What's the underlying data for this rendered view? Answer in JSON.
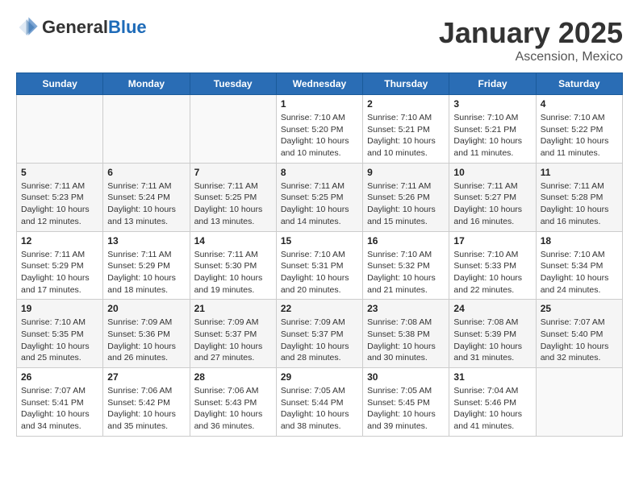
{
  "header": {
    "logo_general": "General",
    "logo_blue": "Blue",
    "month": "January 2025",
    "location": "Ascension, Mexico"
  },
  "days_of_week": [
    "Sunday",
    "Monday",
    "Tuesday",
    "Wednesday",
    "Thursday",
    "Friday",
    "Saturday"
  ],
  "weeks": [
    [
      {
        "day": "",
        "info": ""
      },
      {
        "day": "",
        "info": ""
      },
      {
        "day": "",
        "info": ""
      },
      {
        "day": "1",
        "info": "Sunrise: 7:10 AM\nSunset: 5:20 PM\nDaylight: 10 hours and 10 minutes."
      },
      {
        "day": "2",
        "info": "Sunrise: 7:10 AM\nSunset: 5:21 PM\nDaylight: 10 hours and 10 minutes."
      },
      {
        "day": "3",
        "info": "Sunrise: 7:10 AM\nSunset: 5:21 PM\nDaylight: 10 hours and 11 minutes."
      },
      {
        "day": "4",
        "info": "Sunrise: 7:10 AM\nSunset: 5:22 PM\nDaylight: 10 hours and 11 minutes."
      }
    ],
    [
      {
        "day": "5",
        "info": "Sunrise: 7:11 AM\nSunset: 5:23 PM\nDaylight: 10 hours and 12 minutes."
      },
      {
        "day": "6",
        "info": "Sunrise: 7:11 AM\nSunset: 5:24 PM\nDaylight: 10 hours and 13 minutes."
      },
      {
        "day": "7",
        "info": "Sunrise: 7:11 AM\nSunset: 5:25 PM\nDaylight: 10 hours and 13 minutes."
      },
      {
        "day": "8",
        "info": "Sunrise: 7:11 AM\nSunset: 5:25 PM\nDaylight: 10 hours and 14 minutes."
      },
      {
        "day": "9",
        "info": "Sunrise: 7:11 AM\nSunset: 5:26 PM\nDaylight: 10 hours and 15 minutes."
      },
      {
        "day": "10",
        "info": "Sunrise: 7:11 AM\nSunset: 5:27 PM\nDaylight: 10 hours and 16 minutes."
      },
      {
        "day": "11",
        "info": "Sunrise: 7:11 AM\nSunset: 5:28 PM\nDaylight: 10 hours and 16 minutes."
      }
    ],
    [
      {
        "day": "12",
        "info": "Sunrise: 7:11 AM\nSunset: 5:29 PM\nDaylight: 10 hours and 17 minutes."
      },
      {
        "day": "13",
        "info": "Sunrise: 7:11 AM\nSunset: 5:29 PM\nDaylight: 10 hours and 18 minutes."
      },
      {
        "day": "14",
        "info": "Sunrise: 7:11 AM\nSunset: 5:30 PM\nDaylight: 10 hours and 19 minutes."
      },
      {
        "day": "15",
        "info": "Sunrise: 7:10 AM\nSunset: 5:31 PM\nDaylight: 10 hours and 20 minutes."
      },
      {
        "day": "16",
        "info": "Sunrise: 7:10 AM\nSunset: 5:32 PM\nDaylight: 10 hours and 21 minutes."
      },
      {
        "day": "17",
        "info": "Sunrise: 7:10 AM\nSunset: 5:33 PM\nDaylight: 10 hours and 22 minutes."
      },
      {
        "day": "18",
        "info": "Sunrise: 7:10 AM\nSunset: 5:34 PM\nDaylight: 10 hours and 24 minutes."
      }
    ],
    [
      {
        "day": "19",
        "info": "Sunrise: 7:10 AM\nSunset: 5:35 PM\nDaylight: 10 hours and 25 minutes."
      },
      {
        "day": "20",
        "info": "Sunrise: 7:09 AM\nSunset: 5:36 PM\nDaylight: 10 hours and 26 minutes."
      },
      {
        "day": "21",
        "info": "Sunrise: 7:09 AM\nSunset: 5:37 PM\nDaylight: 10 hours and 27 minutes."
      },
      {
        "day": "22",
        "info": "Sunrise: 7:09 AM\nSunset: 5:37 PM\nDaylight: 10 hours and 28 minutes."
      },
      {
        "day": "23",
        "info": "Sunrise: 7:08 AM\nSunset: 5:38 PM\nDaylight: 10 hours and 30 minutes."
      },
      {
        "day": "24",
        "info": "Sunrise: 7:08 AM\nSunset: 5:39 PM\nDaylight: 10 hours and 31 minutes."
      },
      {
        "day": "25",
        "info": "Sunrise: 7:07 AM\nSunset: 5:40 PM\nDaylight: 10 hours and 32 minutes."
      }
    ],
    [
      {
        "day": "26",
        "info": "Sunrise: 7:07 AM\nSunset: 5:41 PM\nDaylight: 10 hours and 34 minutes."
      },
      {
        "day": "27",
        "info": "Sunrise: 7:06 AM\nSunset: 5:42 PM\nDaylight: 10 hours and 35 minutes."
      },
      {
        "day": "28",
        "info": "Sunrise: 7:06 AM\nSunset: 5:43 PM\nDaylight: 10 hours and 36 minutes."
      },
      {
        "day": "29",
        "info": "Sunrise: 7:05 AM\nSunset: 5:44 PM\nDaylight: 10 hours and 38 minutes."
      },
      {
        "day": "30",
        "info": "Sunrise: 7:05 AM\nSunset: 5:45 PM\nDaylight: 10 hours and 39 minutes."
      },
      {
        "day": "31",
        "info": "Sunrise: 7:04 AM\nSunset: 5:46 PM\nDaylight: 10 hours and 41 minutes."
      },
      {
        "day": "",
        "info": ""
      }
    ]
  ]
}
